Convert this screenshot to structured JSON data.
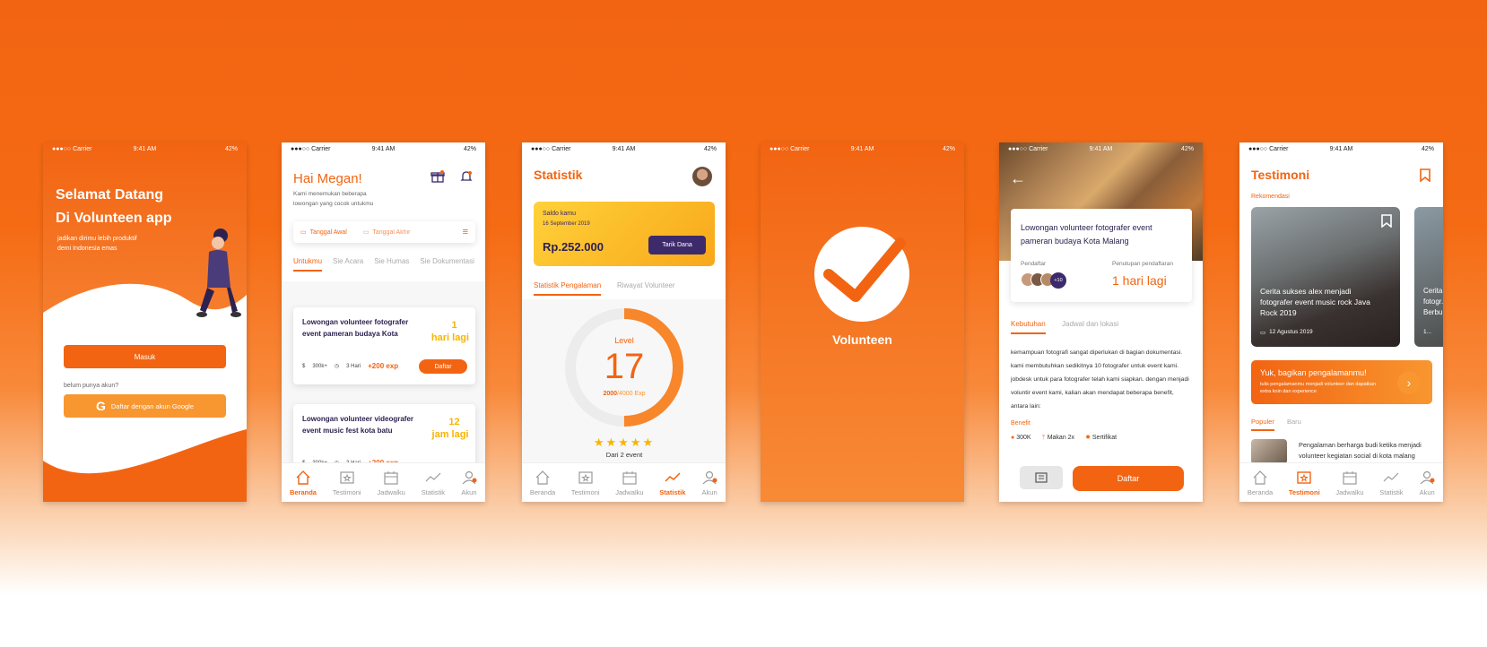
{
  "status": {
    "carrier": "●●●○○ Carrier",
    "time": "9:41 AM",
    "battery": "42%"
  },
  "colors": {
    "accent": "#f26412",
    "dark_button": "#3d2a6b",
    "gold": "#f8b400"
  },
  "welcome": {
    "title1": "Selamat Datang",
    "title2": "Di Volunteen app",
    "sub1": "jadikan dirimu lebih produktif",
    "sub2": "demi Indonesia emas",
    "login": "Masuk",
    "no_account": "belum punya akun?",
    "google": "Daftar dengan akun Google"
  },
  "home": {
    "greeting": "Hai Megan!",
    "sub1": "Kami menemukan beberapa",
    "sub2": "lowongan yang cocok untukmu",
    "date_start": "Tanggal Awal",
    "date_end": "Tanggal Akhir",
    "tabs": [
      "Untukmu",
      "Sie Acara",
      "Sie Humas",
      "Sie Dokumentasi"
    ],
    "job1": {
      "title": "Lowongan volunteer fotografer event pameran budaya Kota",
      "days": "1",
      "days_label": "hari lagi",
      "pay": "300k+",
      "duration": "3 Hari",
      "exp": "+200 exp",
      "cta": "Daftar"
    },
    "job2": {
      "title": "Lowongan volunteer videografer event music fest kota batu",
      "days": "12",
      "days_label": "jam lagi",
      "pay": "300k+",
      "duration": "3 Hari",
      "exp": "+200 exp"
    }
  },
  "tabs": [
    "Beranda",
    "Testimoni",
    "Jadwalku",
    "Statistik",
    "Akun"
  ],
  "stats": {
    "title": "Statistik",
    "saldo_label": "Saldo kamu",
    "date": "16 September 2019",
    "amount": "Rp.252.000",
    "withdraw": "Tarik Dana",
    "tab1": "Statistik Pengalaman",
    "tab2": "Riwayat Volunteer",
    "level_label": "Level",
    "level": "17",
    "exp_now": "2000",
    "exp_total": "/4000 Exp",
    "exp_fraction": 0.5,
    "stars": 5,
    "events": "Dari 2 event"
  },
  "splash": {
    "name": "Volunteen"
  },
  "detail": {
    "title": "Lowongan volunteer fotografer event pameran budaya Kota Malang",
    "registrants_label": "Pendaftar",
    "closing_label": "Penutupan pendaftaran",
    "closing": "1 hari lagi",
    "more": "+10",
    "tab1": "Kebutuhan",
    "tab2": "Jadwal dan lokasi",
    "body": "kemampuan fotografi sangat diperlukan di bagian dokumentasi. kami membutuhkan sedikitnya 10 fotografer untuk event kami. jobdesk untuk para fotografer telah kami siapkan. dengan menjadi voluntir event kami, kalian akan mendapat beberapa benefit, antara lain:",
    "benefit_label": "Benefit",
    "benefits": [
      "300K",
      "Makan 2x",
      "Sertifikat"
    ],
    "cta": "Daftar"
  },
  "testimoni": {
    "title": "Testimoni",
    "reco": "Rekomendasi",
    "card_title": "Cerita sukses alex menjadi fotografer event music rock Java Rock 2019",
    "card_date": "12 Agustus 2019",
    "card2_title": "Cerita... fotogr... Berbu...",
    "card2_date": "1...",
    "share_title": "Yuk, bagikan pengalamanmu!",
    "share_sub": "tulis pengalamanmu menjadi volunteer dan dapatkan extra koin dan experience",
    "tab1": "Populer",
    "tab2": "Baru",
    "item": "Pengalaman berharga budi ketika menjadi volunteer kegiatan social di kota malang"
  }
}
